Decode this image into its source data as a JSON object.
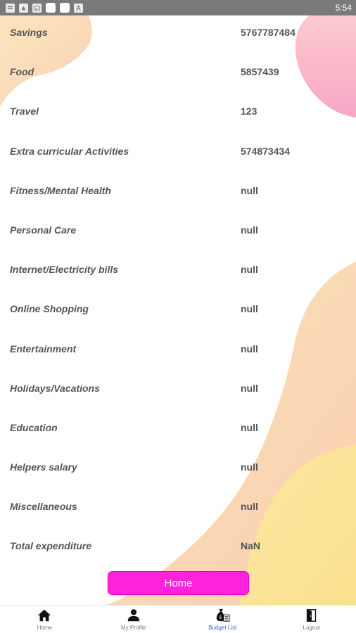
{
  "status_bar": {
    "time": "5:54"
  },
  "budget_list": {
    "items": [
      {
        "label": "Savings",
        "value": "5767787484"
      },
      {
        "label": "Food",
        "value": "5857439"
      },
      {
        "label": "Travel",
        "value": "123"
      },
      {
        "label": "Extra curricular Activities",
        "value": "574873434"
      },
      {
        "label": "Fitness/Mental Health",
        "value": "null"
      },
      {
        "label": "Personal Care",
        "value": "null"
      },
      {
        "label": "Internet/Electricity bills",
        "value": "null"
      },
      {
        "label": "Online Shopping",
        "value": "null"
      },
      {
        "label": "Entertainment",
        "value": "null"
      },
      {
        "label": "Holidays/Vacations",
        "value": "null"
      },
      {
        "label": "Education",
        "value": "null"
      },
      {
        "label": "Helpers salary",
        "value": "null"
      },
      {
        "label": "Miscellaneous",
        "value": "null"
      },
      {
        "label": "Total expenditure",
        "value": "NaN"
      }
    ]
  },
  "home_button": {
    "label": "Home",
    "color": "#ff22dd"
  },
  "bottom_nav": {
    "items": [
      {
        "label": "Home",
        "icon": "home-icon"
      },
      {
        "label": "My Profile",
        "icon": "person-icon"
      },
      {
        "label": "Budget List",
        "icon": "money-bag-icon",
        "active": true
      },
      {
        "label": "Logout",
        "icon": "logout-door-icon"
      }
    ]
  },
  "colors": {
    "blob_peach": "#f9d9a8",
    "blob_pink": "#f8a6c8",
    "blob_yellow": "#fbe49a",
    "active_nav": "#3b66c8"
  }
}
